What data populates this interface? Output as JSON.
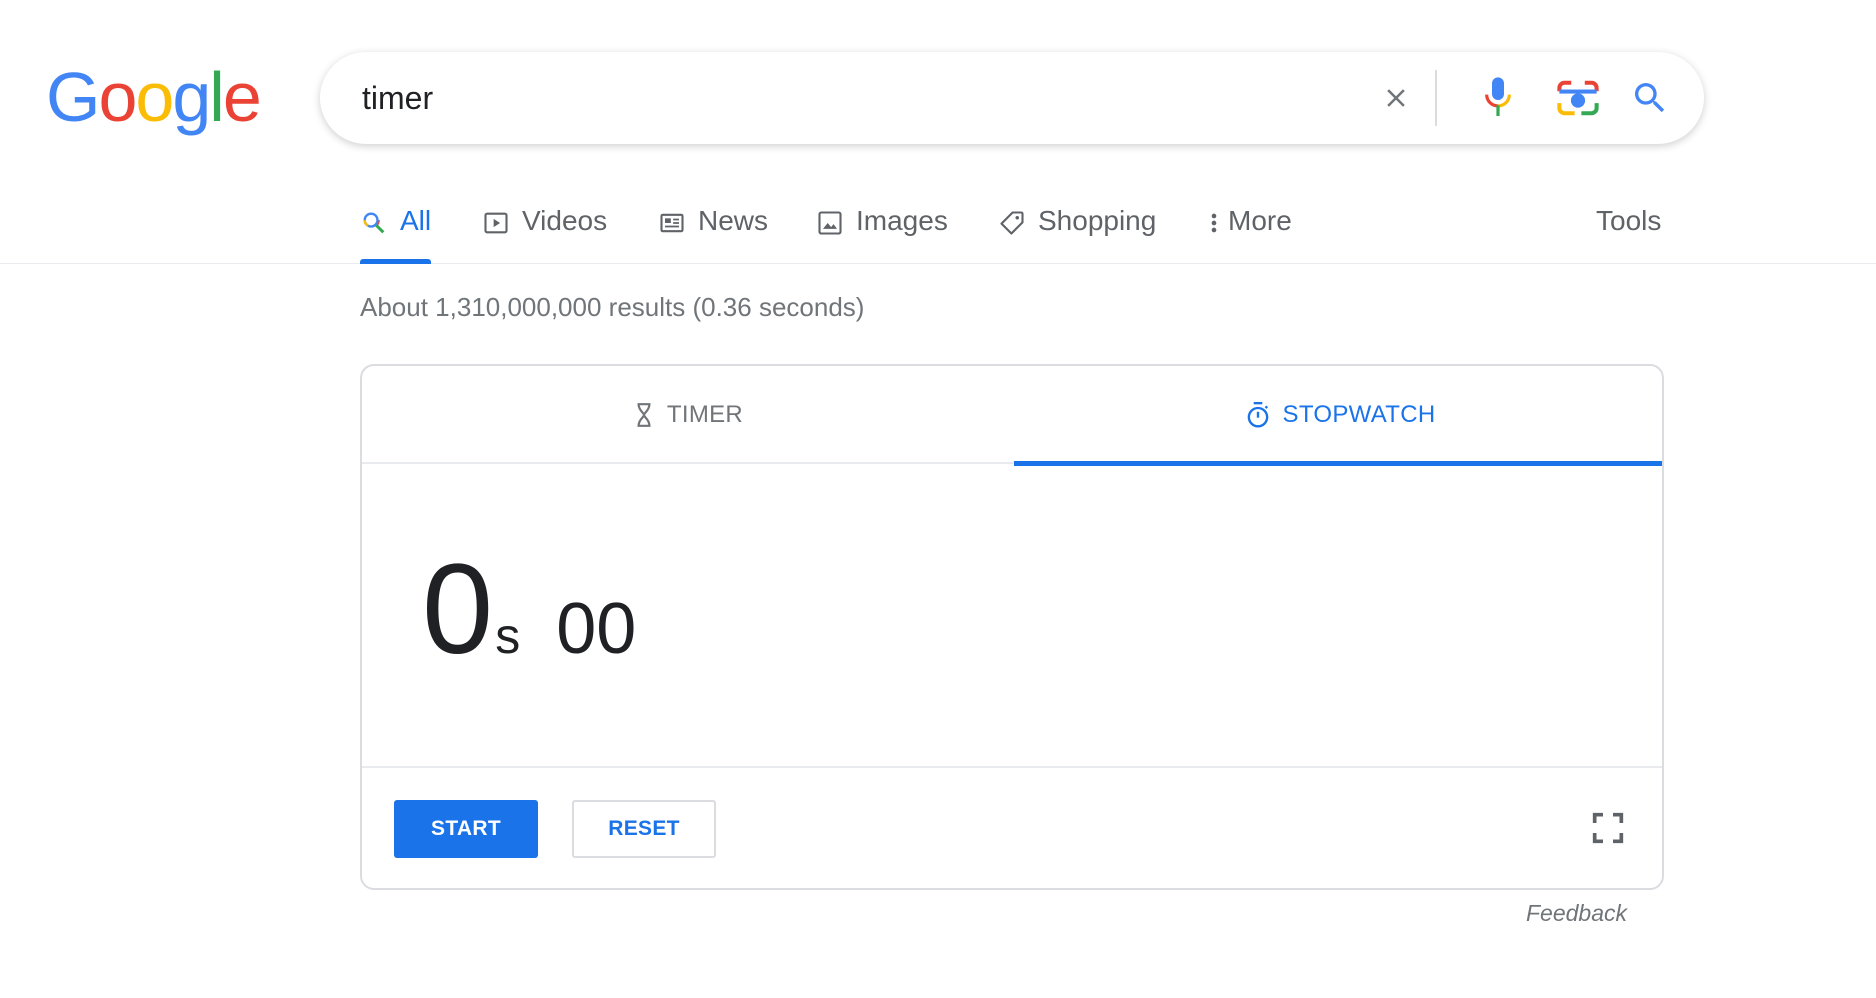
{
  "logo": {
    "letters": [
      "G",
      "o",
      "o",
      "g",
      "l",
      "e"
    ],
    "colors": [
      "#4285F4",
      "#EA4335",
      "#FBBC05",
      "#4285F4",
      "#34A853",
      "#EA4335"
    ]
  },
  "search": {
    "value": "timer",
    "clear_icon": "close-icon",
    "voice_icon": "microphone-icon",
    "lens_icon": "camera-icon",
    "search_icon": "search-icon"
  },
  "tabs": [
    {
      "label": "All",
      "icon": "search-icon",
      "active": true
    },
    {
      "label": "Videos",
      "icon": "play-icon"
    },
    {
      "label": "News",
      "icon": "newspaper-icon"
    },
    {
      "label": "Images",
      "icon": "image-icon"
    },
    {
      "label": "Shopping",
      "icon": "tag-icon"
    },
    {
      "label": "More",
      "icon": "more-vert-icon"
    }
  ],
  "tools_label": "Tools",
  "results_count": "About 1,310,000,000 results (0.36 seconds)",
  "widget": {
    "tabs": [
      {
        "label": "TIMER",
        "icon": "hourglass-icon",
        "active": false
      },
      {
        "label": "STOPWATCH",
        "icon": "stopwatch-icon",
        "active": true
      }
    ],
    "display": {
      "seconds": "0",
      "unit": "s",
      "hundredths": "00"
    },
    "start_label": "START",
    "reset_label": "RESET",
    "fullscreen_icon": "fullscreen-icon"
  },
  "feedback_label": "Feedback",
  "colors": {
    "accent": "#1a73e8",
    "muted": "#5f6368",
    "border": "#dadce0"
  }
}
